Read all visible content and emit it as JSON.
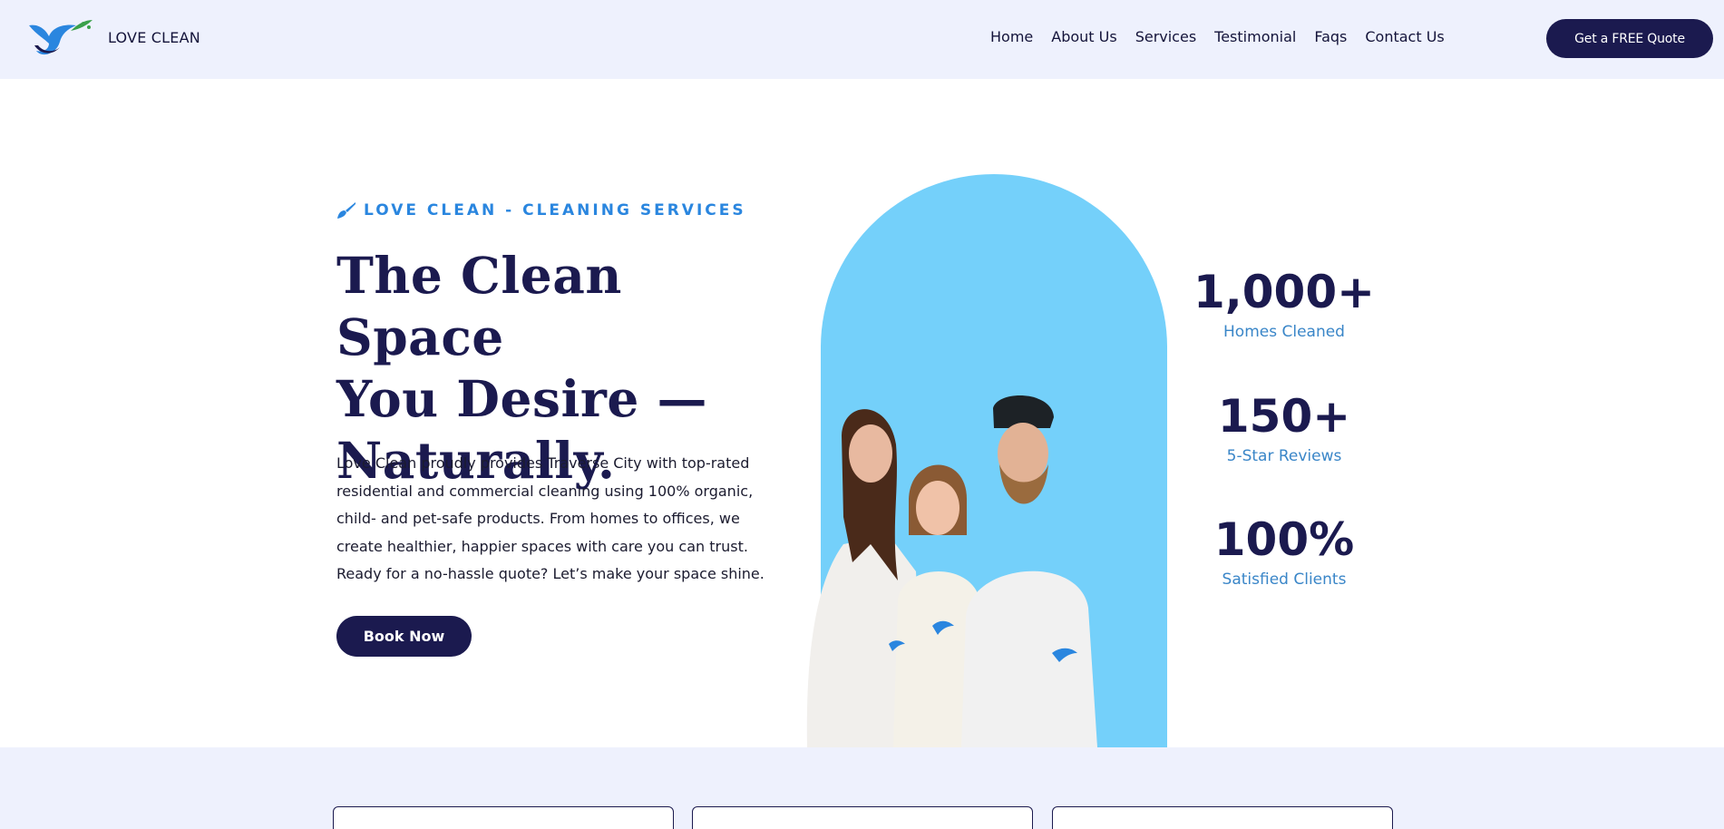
{
  "header": {
    "brand": "LOVE CLEAN",
    "nav": [
      "Home",
      "About Us",
      "Services",
      "Testimonial",
      "Faqs",
      "Contact Us"
    ],
    "cta_label": "Get a FREE Quote"
  },
  "hero": {
    "tagline": "LOVE CLEAN - CLEANING SERVICES",
    "headline_line1": "The Clean Space",
    "headline_line2": "You Desire —",
    "headline_line3": "Naturally.",
    "intro": "Love Clean proudly provides Traverse City with top-rated residential and commercial cleaning using 100% organic, child- and pet-safe products. From homes to offices, we create healthier, happier spaces with care you can trust. Ready for a no-hassle quote? Let’s make your space shine.",
    "book_label": "Book Now"
  },
  "stats": [
    {
      "value": "1,000+",
      "label": "Homes Cleaned"
    },
    {
      "value": "150+",
      "label": "5-Star Reviews"
    },
    {
      "value": "100%",
      "label": "Satisfied Clients"
    }
  ],
  "colors": {
    "header_bg": "#eef1fd",
    "brand_navy": "#1b1a4f",
    "accent_blue": "#2a86df",
    "arch_blue": "#74d0fa"
  },
  "icons": {
    "logo": "bird-logo-icon",
    "tagline": "brush-icon"
  }
}
